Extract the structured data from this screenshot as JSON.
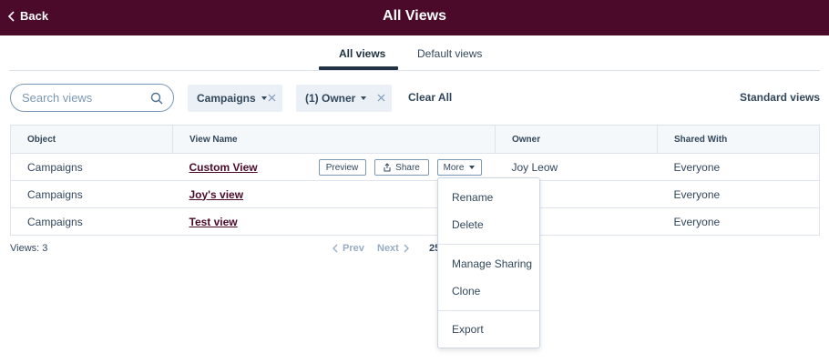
{
  "header": {
    "back_label": "Back",
    "title": "All Views",
    "bg_color": "#4b0a2a"
  },
  "tabs": [
    {
      "label": "All views",
      "active": true
    },
    {
      "label": "Default views",
      "active": false
    }
  ],
  "search": {
    "placeholder": "Search views",
    "value": ""
  },
  "filters": [
    {
      "label": "Campaigns"
    },
    {
      "label": "(1) Owner"
    }
  ],
  "clear_all_label": "Clear All",
  "standard_views_label": "Standard views",
  "table": {
    "columns": [
      "Object",
      "View Name",
      "Owner",
      "Shared With"
    ],
    "rows": [
      {
        "object": "Campaigns",
        "view_name": "Custom View",
        "owner": "Joy Leow",
        "shared_with": "Everyone"
      },
      {
        "object": "Campaigns",
        "view_name": "Joy's view",
        "owner": "eow",
        "shared_with": "Everyone"
      },
      {
        "object": "Campaigns",
        "view_name": "Test view",
        "owner": "eow",
        "shared_with": "Everyone"
      }
    ],
    "row_actions": {
      "preview": "Preview",
      "share": "Share",
      "more": "More"
    }
  },
  "footer": {
    "views_count": "Views: 3",
    "prev": "Prev",
    "next": "Next",
    "per_page": "25"
  },
  "more_menu": {
    "items": [
      "Rename",
      "Delete",
      "Manage Sharing",
      "Clone",
      "Export"
    ]
  }
}
